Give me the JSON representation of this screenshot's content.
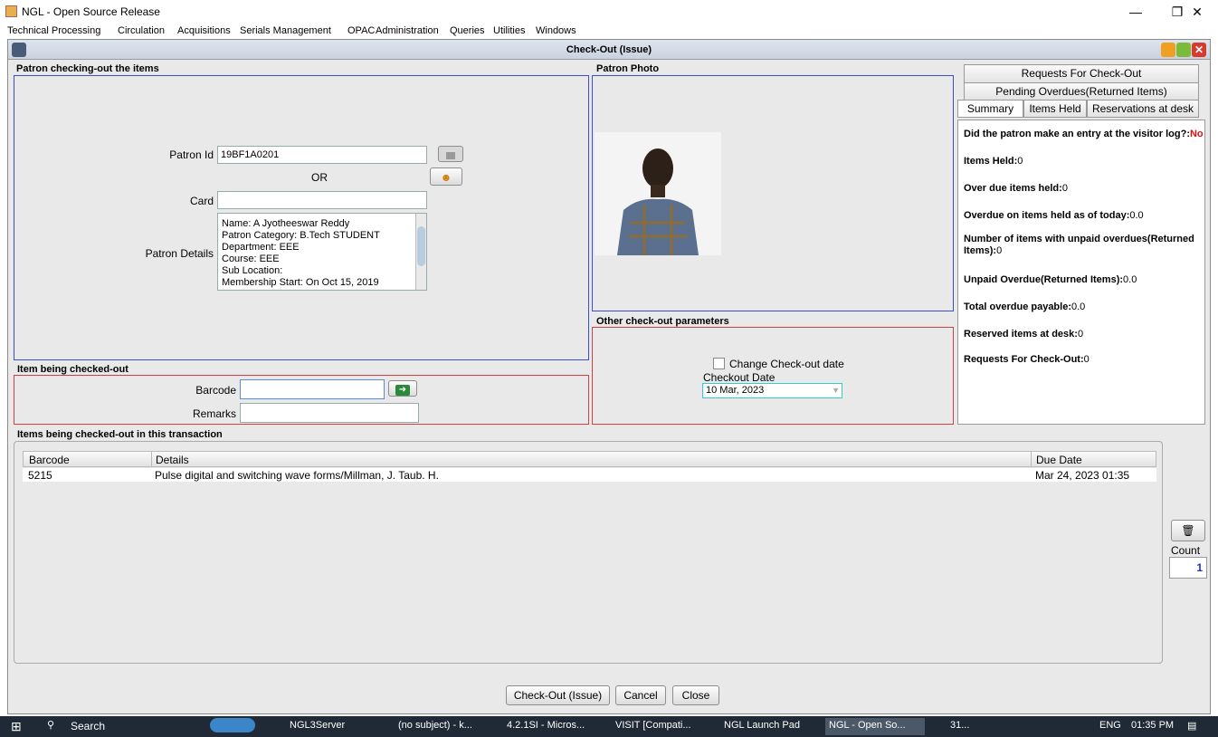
{
  "window": {
    "title": "NGL - Open Source Release"
  },
  "menu": [
    "Technical Processing",
    "Circulation",
    "Acquisitions",
    "Serials Management",
    "OPAC",
    "Administration",
    "Queries",
    "Utilities",
    "Windows"
  ],
  "frame": {
    "title": "Check-Out (Issue)"
  },
  "patron_panel": {
    "title": "Patron checking-out the items",
    "patron_id_label": "Patron Id",
    "patron_id_value": "19BF1A0201",
    "or_label": "OR",
    "card_label": "Card",
    "card_value": "",
    "details_label": "Patron Details",
    "details_lines": [
      "Name: A Jyotheeswar Reddy",
      "Patron Category: B.Tech STUDENT",
      "Department: EEE",
      "Course: EEE",
      "Sub Location:",
      "Membership Start: On Oct 15, 2019"
    ]
  },
  "photo_panel": {
    "title": "Patron Photo"
  },
  "item_panel": {
    "title": "Item being checked-out",
    "barcode_label": "Barcode",
    "barcode_value": "",
    "remarks_label": "Remarks",
    "remarks_value": ""
  },
  "params_panel": {
    "title": "Other check-out parameters",
    "change_date_label": "Change Check-out date",
    "checkout_date_label": "Checkout Date",
    "checkout_date_value": "10 Mar, 2023"
  },
  "tabs": {
    "row1": "Requests For Check-Out",
    "row2": "Pending Overdues(Returned Items)",
    "row3": [
      "Summary",
      "Items Held",
      "Reservations at desk"
    ]
  },
  "summary": {
    "visitor_log_label": "Did the patron make an entry at the visitor log?:",
    "visitor_log_value": "No",
    "items_held_label": "Items Held:",
    "items_held_value": "0",
    "overdue_items_label": "Over due items held:",
    "overdue_items_value": "0",
    "overdue_today_label": "Overdue on items held as of today:",
    "overdue_today_value": "0.0",
    "unpaid_count_label": "Number of items with unpaid overdues(Returned Items):",
    "unpaid_count_value": "0",
    "unpaid_amount_label": "Unpaid Overdue(Returned Items):",
    "unpaid_amount_value": "0.0",
    "total_payable_label": "Total overdue payable:",
    "total_payable_value": "0.0",
    "reserved_label": "Reserved items at desk:",
    "reserved_value": "0",
    "requests_label": "Requests For Check-Out:",
    "requests_value": "0"
  },
  "transaction": {
    "title": "Items being checked-out in this transaction",
    "columns": [
      "Barcode",
      "Details",
      "Due Date"
    ],
    "rows": [
      {
        "barcode": "5215",
        "details": "Pulse digital and switching wave forms/Millman, J. Taub. H.",
        "due": "Mar 24, 2023 01:35"
      }
    ],
    "count_label": "Count",
    "count_value": "1"
  },
  "buttons": {
    "checkout": "Check-Out (Issue)",
    "cancel": "Cancel",
    "close": "Close"
  },
  "taskbar": {
    "search": "Search",
    "items": [
      "NGL3Server",
      "(no subject) - k...",
      "4.2.1SI - Micros...",
      "VISIT [Compati...",
      "NGL Launch Pad",
      "NGL - Open So..."
    ],
    "weather": "31...",
    "lang": "ENG",
    "time": "01:35 PM"
  }
}
